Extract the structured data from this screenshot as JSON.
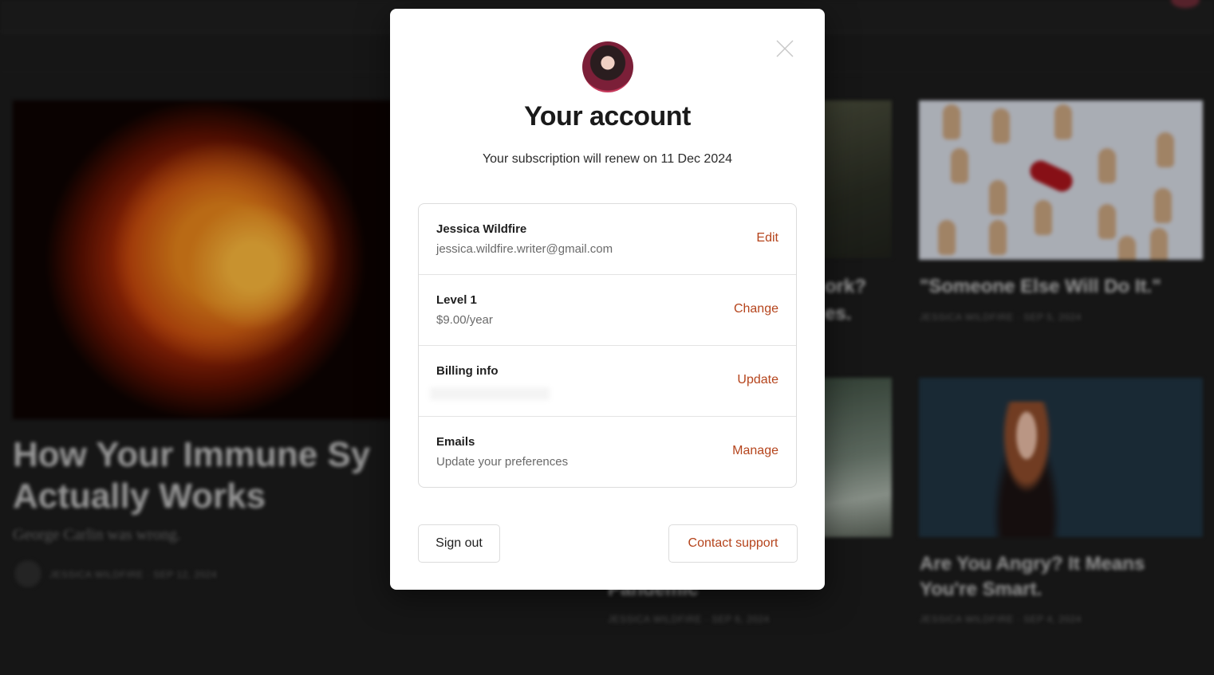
{
  "background": {
    "articles": [
      {
        "title_line1": "How Your Immune Sy",
        "title_line2": "Actually Works",
        "subtitle": "George Carlin was wrong.",
        "meta": "JESSICA WILDFIRE · SEP 12, 2024"
      },
      {
        "title_line1": "\"Someone Else Will Do It.\"",
        "meta": "JESSICA WILDFIRE · SEP 5, 2024"
      },
      {
        "title_line1": "Are You Angry? It Means",
        "title_line2": "You're Smart.",
        "meta": "JESSICA WILDFIRE · SEP 4, 2024"
      },
      {
        "title_fragment_1": "ork?",
        "title_fragment_2": "es.",
        "title_fragment_3": "Pandemic",
        "meta": "JESSICA WILDFIRE · SEP 6, 2024"
      }
    ]
  },
  "modal": {
    "title": "Your account",
    "subtitle": "Your subscription will renew on 11 Dec 2024",
    "rows": [
      {
        "title": "Jessica Wildfire",
        "subtitle": "jessica.wildfire.writer@gmail.com",
        "action": "Edit"
      },
      {
        "title": "Level 1",
        "subtitle": "$9.00/year",
        "action": "Change"
      },
      {
        "title": "Billing info",
        "subtitle": "",
        "action": "Update"
      },
      {
        "title": "Emails",
        "subtitle": "Update your preferences",
        "action": "Manage"
      }
    ],
    "sign_out_label": "Sign out",
    "contact_support_label": "Contact support",
    "icons": {
      "close": "close-icon",
      "avatar": "avatar"
    }
  },
  "colors": {
    "accent": "#b5441c",
    "modal_bg": "#ffffff",
    "page_bg": "#1b1b1b"
  }
}
